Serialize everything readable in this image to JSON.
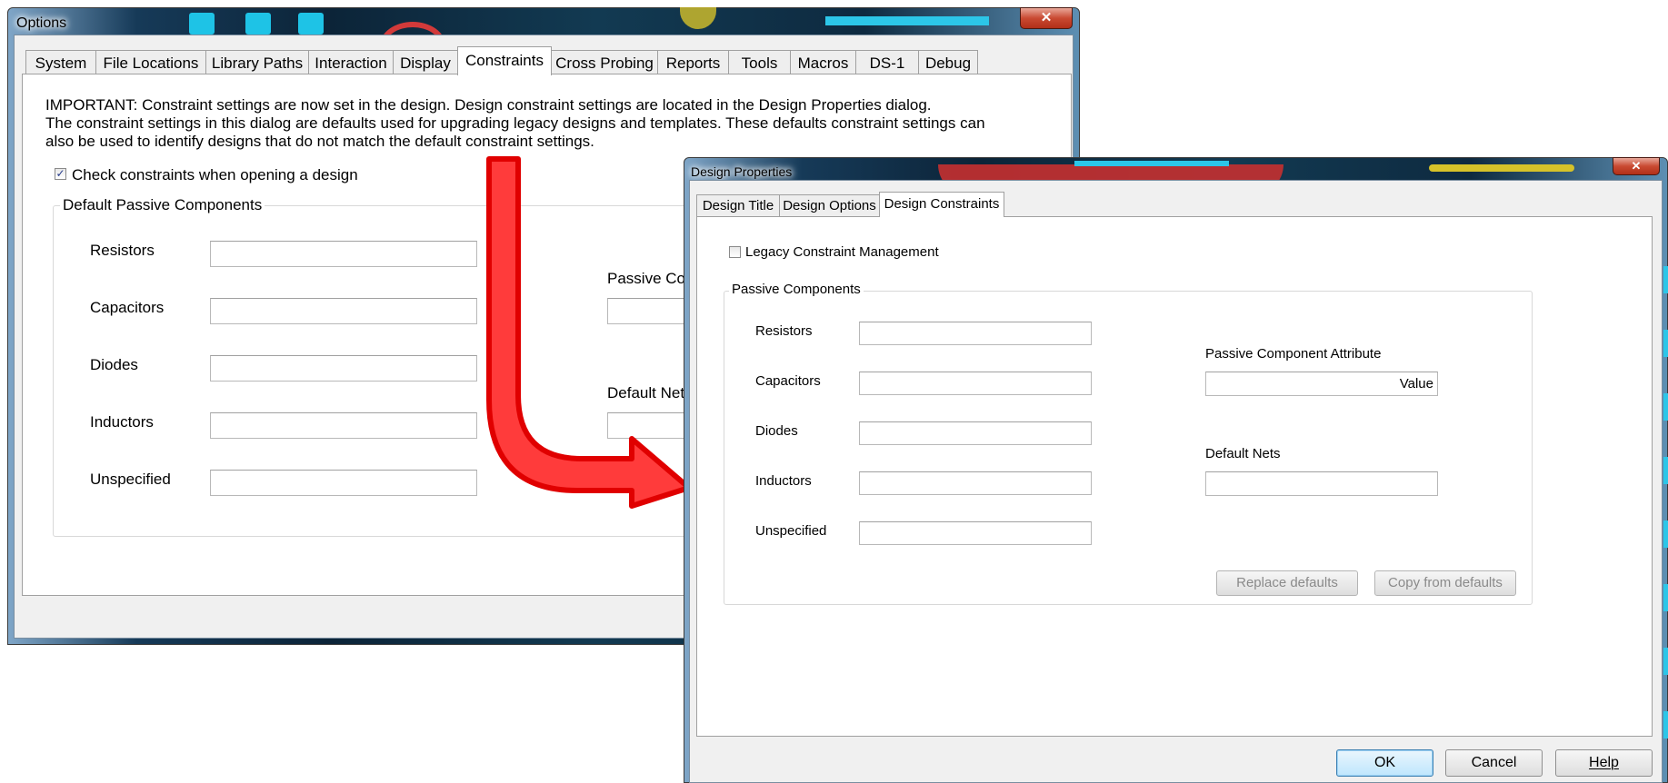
{
  "options_window": {
    "title": "Options",
    "tabs": [
      "System",
      "File Locations",
      "Library Paths",
      "Interaction",
      "Display",
      "Constraints",
      "Cross Probing",
      "Reports",
      "Tools",
      "Macros",
      "DS-1",
      "Debug"
    ],
    "active_tab": "Constraints",
    "important_text": "IMPORTANT: Constraint settings are now set in the design. Design constraint settings are located in the Design Properties dialog.",
    "info_line2": "The constraint settings in this dialog are defaults used for upgrading legacy designs and templates. These defaults constraint settings can",
    "info_line3": "also be used to identify designs that do not match the default constraint settings.",
    "check_constraints_label": "Check constraints when opening a design",
    "check_constraints_checked": true,
    "group_label": "Default Passive Components",
    "fields": [
      "Resistors",
      "Capacitors",
      "Diodes",
      "Inductors",
      "Unspecified"
    ],
    "passive_attr_label_partial": "Passive Co",
    "default_nets_label_partial": "Default Net",
    "close_glyph": "✕"
  },
  "design_properties_window": {
    "title": "Design Properties",
    "tabs": [
      "Design Title",
      "Design Options",
      "Design Constraints"
    ],
    "active_tab": "Design Constraints",
    "legacy_label": "Legacy Constraint Management",
    "legacy_checked": false,
    "group_label": "Passive Components",
    "fields": [
      "Resistors",
      "Capacitors",
      "Diodes",
      "Inductors",
      "Unspecified"
    ],
    "passive_attr_label": "Passive Component Attribute",
    "passive_attr_value": "Value",
    "default_nets_label": "Default Nets",
    "replace_defaults": "Replace defaults",
    "copy_from_defaults": "Copy from defaults",
    "ok": "OK",
    "cancel": "Cancel",
    "help": "Help",
    "close_glyph": "✕"
  },
  "colors": {
    "arrow_fill": "#ff3b3b",
    "arrow_stroke": "#e00000"
  }
}
